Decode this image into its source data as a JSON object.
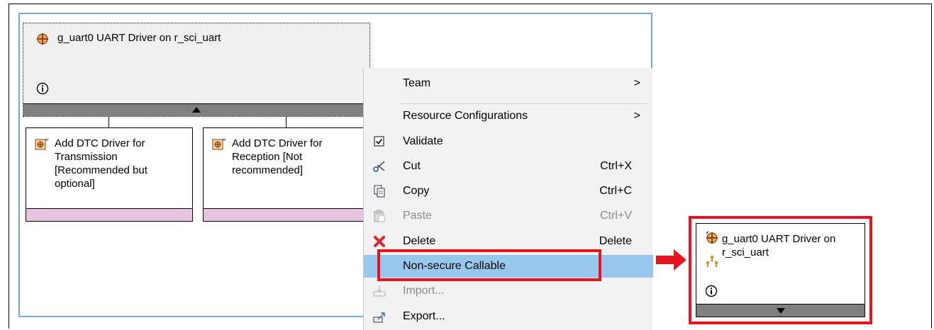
{
  "stack": {
    "module_title": "g_uart0 UART Driver on r_sci_uart",
    "children": [
      {
        "label": "Add DTC Driver for\nTransmission\n[Recommended but\noptional]"
      },
      {
        "label": "Add DTC Driver for\nReception [Not\nrecommended]"
      }
    ]
  },
  "context_menu": {
    "items": [
      {
        "label": "Team",
        "submenu": ">"
      },
      {
        "label": "Resource Configurations",
        "submenu": ">"
      },
      {
        "label": "Validate",
        "icon": "checkbox-icon"
      },
      {
        "label": "Cut",
        "shortcut": "Ctrl+X",
        "icon": "scissors-icon"
      },
      {
        "label": "Copy",
        "shortcut": "Ctrl+C",
        "icon": "copy-icon"
      },
      {
        "label": "Paste",
        "shortcut": "Ctrl+V",
        "icon": "paste-icon",
        "disabled": true
      },
      {
        "label": "Delete",
        "shortcut": "Delete",
        "icon": "delete-icon"
      },
      {
        "label": "Non-secure Callable",
        "highlighted": true
      },
      {
        "label": "Import...",
        "icon": "import-icon",
        "disabled": true
      },
      {
        "label": "Export...",
        "icon": "export-icon"
      }
    ]
  },
  "result_card": {
    "title": "g_uart0 UART Driver on r_sci_uart"
  },
  "colors": {
    "highlight": "#99c8ee",
    "callout": "#e8141e",
    "stack_footer": "#e8c4e0"
  }
}
